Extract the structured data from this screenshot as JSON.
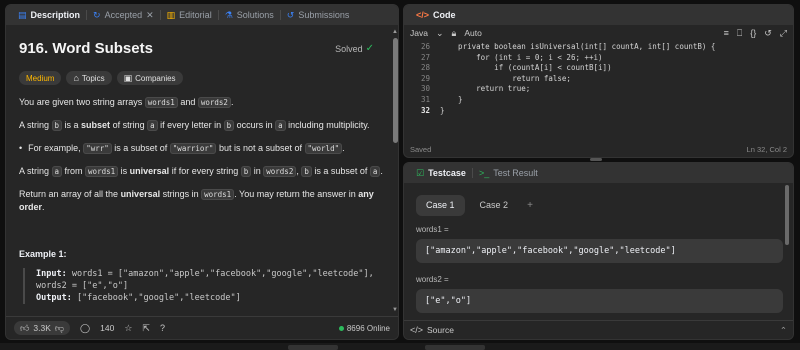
{
  "tabs": {
    "description": "Description",
    "accepted": "Accepted",
    "editorial": "Editorial",
    "solutions": "Solutions",
    "submissions": "Submissions"
  },
  "problem": {
    "title": "916. Word Subsets",
    "status": "Solved",
    "difficulty": "Medium",
    "topics": "Topics",
    "companies": "Companies"
  },
  "description": {
    "p1a": "You are given two string arrays ",
    "p1b": "words1",
    "p1c": " and ",
    "p1d": "words2",
    "p1e": ".",
    "p2a": "A string ",
    "p2b": "b",
    "p2c": " is a ",
    "p2d": "subset",
    "p2e": " of string ",
    "p2f": "a",
    "p2g": " if every letter in ",
    "p2h": "b",
    "p2i": " occurs in ",
    "p2j": "a",
    "p2k": " including multiplicity.",
    "b1a": "For example, ",
    "b1b": "\"wrr\"",
    "b1c": " is a subset of ",
    "b1d": "\"warrior\"",
    "b1e": " but is not a subset of ",
    "b1f": "\"world\"",
    "b1g": ".",
    "p3a": "A string ",
    "p3b": "a",
    "p3c": " from ",
    "p3d": "words1",
    "p3e": " is ",
    "p3f": "universal",
    "p3g": " if for every string ",
    "p3h": "b",
    "p3i": " in ",
    "p3j": "words2",
    "p3k": ", ",
    "p3l": "b",
    "p3m": " is a subset of ",
    "p3n": "a",
    "p3o": ".",
    "p4a": "Return an array of all the ",
    "p4b": "universal",
    "p4c": " strings in ",
    "p4d": "words1",
    "p4e": ". You may return the answer in ",
    "p4f": "any order",
    "p4g": "."
  },
  "example": {
    "title": "Example 1:",
    "input_label": "Input:",
    "input_line1": " words1 = [\"amazon\",\"apple\",\"facebook\",\"google\",\"leetcode\"],",
    "input_line2": "words2 = [\"e\",\"o\"]",
    "output_label": "Output:",
    "output_value": " [\"facebook\",\"google\",\"leetcode\"]"
  },
  "footer": {
    "likes": "3.3K",
    "comments": "140",
    "online": "8696 Online"
  },
  "code_panel": {
    "title": "Code",
    "language": "Java",
    "mode": "Auto",
    "status_left": "Saved",
    "status_right": "Ln 32, Col 2",
    "lines": [
      {
        "num": "26",
        "text": "    private boolean isUniversal(int[] countA, int[] countB) {"
      },
      {
        "num": "27",
        "text": "        for (int i = 0; i < 26; ++i)"
      },
      {
        "num": "28",
        "text": "            if (countA[i] < countB[i])"
      },
      {
        "num": "29",
        "text": "                return false;"
      },
      {
        "num": "30",
        "text": "        return true;"
      },
      {
        "num": "31",
        "text": "    }"
      },
      {
        "num": "32",
        "text": "}"
      }
    ]
  },
  "testcase": {
    "tab_testcase": "Testcase",
    "tab_result": "Test Result",
    "case1": "Case 1",
    "case2": "Case 2",
    "plus": "+",
    "label1": "words1 =",
    "value1": "[\"amazon\",\"apple\",\"facebook\",\"google\",\"leetcode\"]",
    "label2": "words2 =",
    "value2": "[\"e\",\"o\"]",
    "source": "Source"
  },
  "colors": {
    "accent_green": "#2cbb5d",
    "medium": "#ffb800",
    "code_tab_icon": "#ff7a45"
  }
}
